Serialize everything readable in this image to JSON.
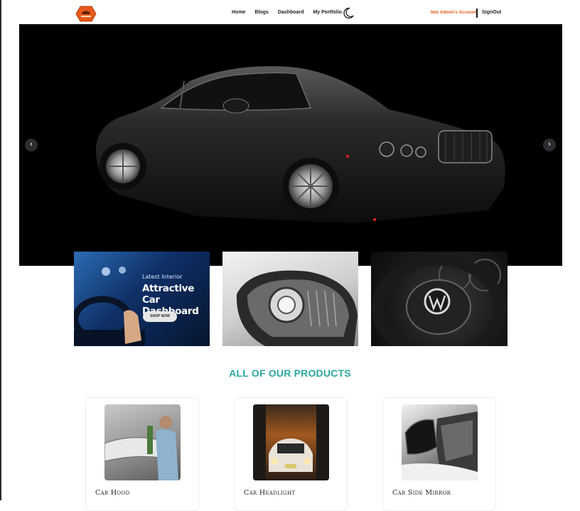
{
  "nav": {
    "logo_icon": "brand-logo-icon",
    "links": [
      "Home",
      "Blogs",
      "Dashboard",
      "My Portfolio"
    ],
    "theme_icon": "moon-icon",
    "admin_status": "Not Admin's Account",
    "signout": "SignOut"
  },
  "hero": {
    "prev_arrow": "‹",
    "next_arrow": "›"
  },
  "banners": {
    "interior": {
      "subtitle": "Latest Interior",
      "title": "Attractive Car Dashboard",
      "button": "SHOP NOW"
    }
  },
  "products": {
    "heading": "ALL OF OUR PRODUCTS",
    "items": [
      {
        "name": "Car Hood"
      },
      {
        "name": "Car Headlight"
      },
      {
        "name": "Car Side Mirror"
      }
    ]
  },
  "colors": {
    "accent": "#2aa7a0",
    "admin_status": "#e8581c",
    "logo": "#e8581c"
  }
}
